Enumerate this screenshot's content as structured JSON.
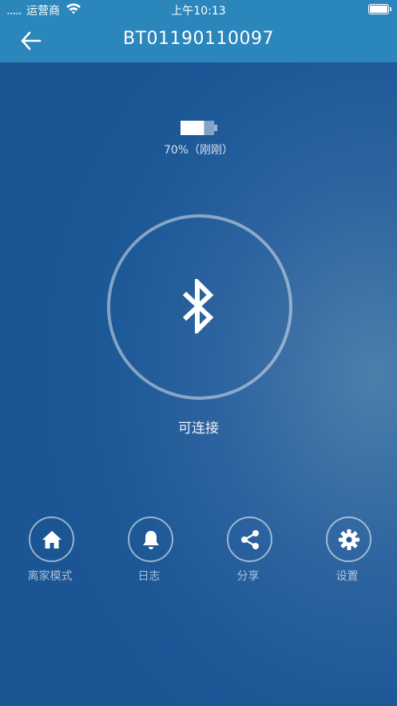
{
  "status_bar": {
    "signal": "•••••",
    "carrier": "运营商",
    "time": "上午10:13",
    "wifi_icon": "wifi-icon",
    "battery_icon": "battery-full-icon"
  },
  "nav": {
    "back_icon": "arrow-left-icon",
    "title": "BT01190110097"
  },
  "device": {
    "battery_level": 0.7,
    "battery_text": "70%（刚刚）",
    "connect_icon": "bluetooth-icon",
    "status": "可连接"
  },
  "actions": [
    {
      "label": "离家模式",
      "icon": "home-icon"
    },
    {
      "label": "日志",
      "icon": "bell-icon"
    },
    {
      "label": "分享",
      "icon": "share-icon"
    },
    {
      "label": "设置",
      "icon": "gear-icon"
    }
  ],
  "colors": {
    "header": "#2a86bb",
    "background": "#1d5897",
    "background_glow": "#4d7fab"
  }
}
